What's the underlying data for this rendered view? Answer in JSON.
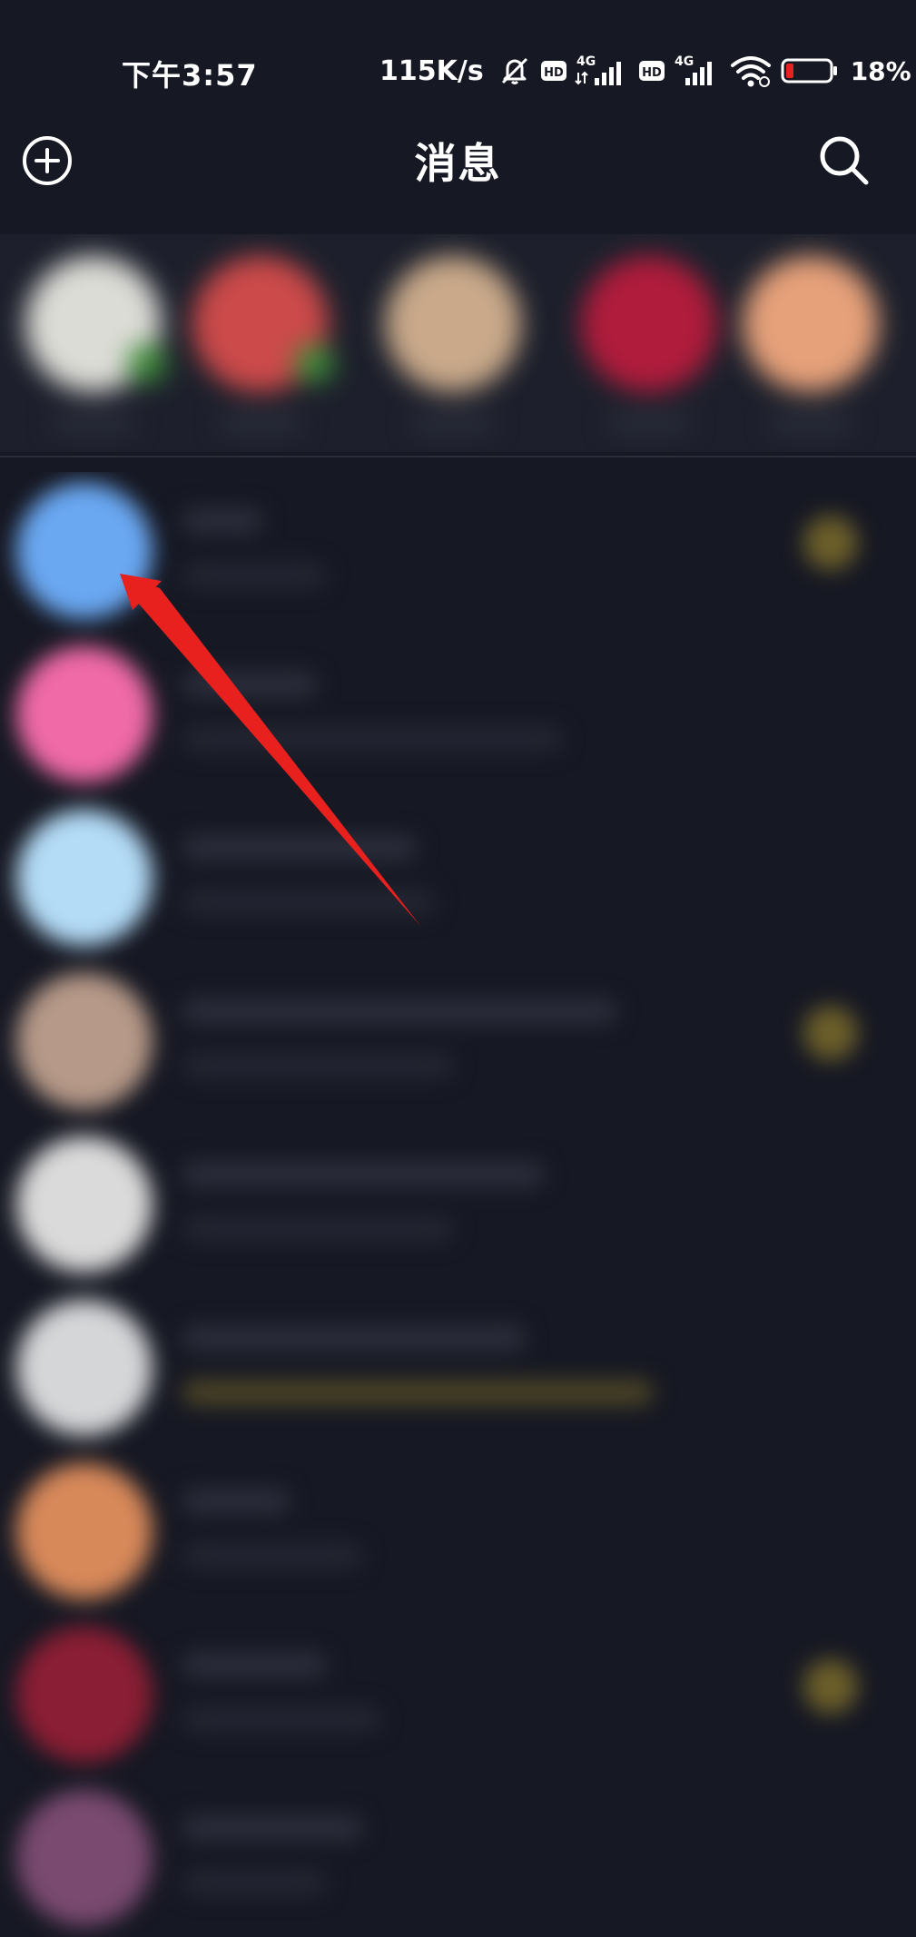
{
  "status_bar": {
    "time": "下午3:57",
    "network_speed": "115K/s",
    "battery_percent": "18%",
    "battery_level": 0.18,
    "icons": [
      "mute-icon",
      "hd-icon",
      "4g-signal-icon",
      "hd-icon",
      "4g-signal-icon",
      "wifi-icon",
      "battery-icon"
    ]
  },
  "header": {
    "title": "消息",
    "left_icon": "add-circle-icon",
    "right_icon": "search-icon"
  },
  "colors": {
    "background": "#161823",
    "arrow": "#e8201e",
    "text": "#ffffff"
  },
  "contacts_strip": {
    "avatar_colors": [
      "#dcdcd6",
      "#cc4a4a",
      "#c9a98a",
      "#b01c3c",
      "#e6a17a"
    ]
  },
  "conversation_list": {
    "avatar_colors": [
      "#6aa8f2",
      "#f06aa8",
      "#b4dcf7",
      "#b69988",
      "#dadada",
      "#d4d6d8",
      "#d8895a",
      "#8a1e34",
      "#7a4a70"
    ],
    "unread_dots": [
      true,
      false,
      false,
      true,
      false,
      false,
      false,
      true,
      false
    ]
  }
}
